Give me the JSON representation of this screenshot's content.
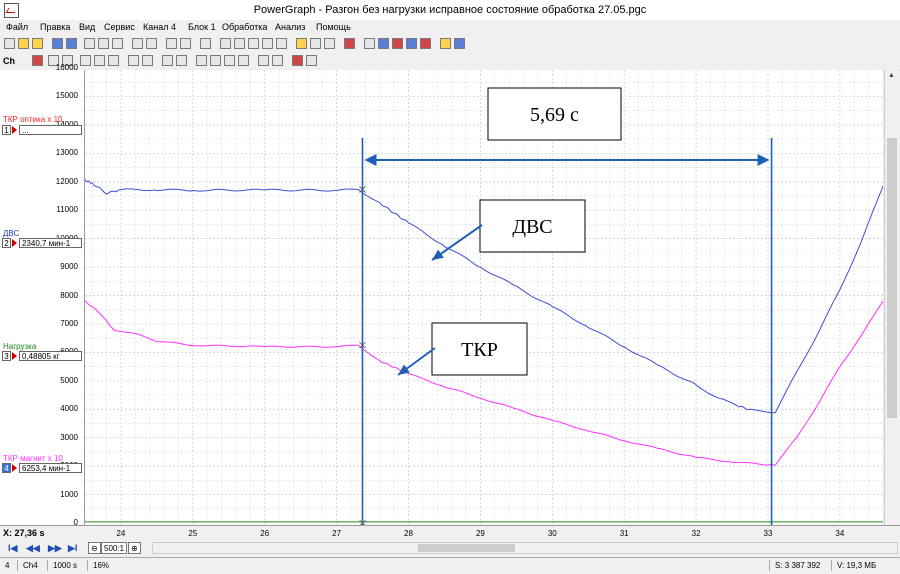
{
  "window": {
    "title": "PowerGraph - Разгон без нагрузки исправное состояние обработка 27.05.pgc"
  },
  "menu": [
    "Файл",
    "Правка",
    "Вид",
    "Сервис",
    "Канал 4",
    "Блок 1",
    "Обработка",
    "Анализ",
    "Помощь"
  ],
  "toolbar2": {
    "channel_label": "Ch"
  },
  "y_ticks": [
    "16000",
    "15000",
    "14000",
    "13000",
    "12000",
    "11000",
    "10000",
    "9000",
    "8000",
    "7000",
    "6000",
    "5000",
    "4000",
    "3000",
    "2000",
    "1000",
    "0"
  ],
  "channels": [
    {
      "name": "ТКР оптика x 10",
      "num": "1",
      "value": "...",
      "color": "#ff2020"
    },
    {
      "name": "ДВС",
      "num": "2",
      "value": "2340,7 мин-1",
      "color": "#1e3fd0"
    },
    {
      "name": "Нагрузка",
      "num": "3",
      "value": "0,48805 кг",
      "color": "#1a8a1a"
    },
    {
      "name": "ТКР магнит x 10",
      "num": "4",
      "value": "6253,4 мин-1",
      "color": "#ff2fff"
    }
  ],
  "x_axis": {
    "readout": "X: 27,36 s",
    "ticks": [
      "24",
      "25",
      "26",
      "27",
      "28",
      "29",
      "30",
      "31",
      "32",
      "33",
      "34"
    ]
  },
  "nav": {
    "first": "I◀",
    "prev": "◀◀",
    "next": "▶▶",
    "last": "▶I",
    "zoom": "500:1"
  },
  "status": {
    "channel_num": "4",
    "channel": "Ch4",
    "rate": "1000 s",
    "percent": "16%",
    "samples": "S: 3 387 392",
    "size": "V: 19,3 МБ"
  },
  "annotations": {
    "interval": "5,69 с",
    "dvs": "ДВС",
    "tkr": "ТКР"
  },
  "colors": {
    "dvs": "#3b4fd8",
    "tkr": "#ff30ff",
    "load": "#1a8a1a",
    "marker": "#1f5fb5",
    "grid": "#c8c8c8"
  },
  "chart_data": {
    "type": "line",
    "xlabel": "",
    "ylabel": "",
    "xlim": [
      23.5,
      34.6
    ],
    "ylim": [
      0,
      16000
    ],
    "series": [
      {
        "name": "ДВС",
        "points": [
          [
            23.5,
            12050
          ],
          [
            23.6,
            11950
          ],
          [
            23.8,
            11600
          ],
          [
            24.0,
            11720
          ],
          [
            24.5,
            11720
          ],
          [
            25,
            11700
          ],
          [
            26,
            11710
          ],
          [
            27,
            11700
          ],
          [
            27.3,
            11730
          ],
          [
            27.6,
            11250
          ],
          [
            28,
            10550
          ],
          [
            28.5,
            9750
          ],
          [
            29,
            9000
          ],
          [
            29.5,
            8300
          ],
          [
            30,
            7600
          ],
          [
            30.5,
            6900
          ],
          [
            31,
            6200
          ],
          [
            31.5,
            5500
          ],
          [
            32,
            4850
          ],
          [
            32.3,
            4400
          ],
          [
            32.6,
            4100
          ],
          [
            32.8,
            3950
          ],
          [
            33.1,
            3900
          ],
          [
            33.4,
            5300
          ],
          [
            33.7,
            6700
          ],
          [
            34,
            8200
          ],
          [
            34.3,
            9900
          ],
          [
            34.6,
            11850
          ]
        ]
      },
      {
        "name": "ТКР",
        "points": [
          [
            23.5,
            7800
          ],
          [
            23.7,
            7400
          ],
          [
            23.9,
            6800
          ],
          [
            24.2,
            6650
          ],
          [
            24.5,
            6400
          ],
          [
            25,
            6250
          ],
          [
            26,
            6200
          ],
          [
            27,
            6200
          ],
          [
            27.3,
            6250
          ],
          [
            27.6,
            5700
          ],
          [
            28,
            5250
          ],
          [
            28.5,
            4800
          ],
          [
            29,
            4400
          ],
          [
            29.5,
            4000
          ],
          [
            30,
            3600
          ],
          [
            30.5,
            3250
          ],
          [
            31,
            2900
          ],
          [
            31.5,
            2600
          ],
          [
            32,
            2300
          ],
          [
            32.5,
            2150
          ],
          [
            33.0,
            2050
          ],
          [
            33.1,
            2050
          ],
          [
            33.4,
            3000
          ],
          [
            33.7,
            4200
          ],
          [
            34,
            5500
          ],
          [
            34.3,
            6600
          ],
          [
            34.6,
            7800
          ]
        ]
      },
      {
        "name": "Нагрузка",
        "points": [
          [
            23.5,
            40
          ],
          [
            34.6,
            40
          ]
        ]
      }
    ],
    "markers": [
      27.36,
      33.05
    ]
  }
}
